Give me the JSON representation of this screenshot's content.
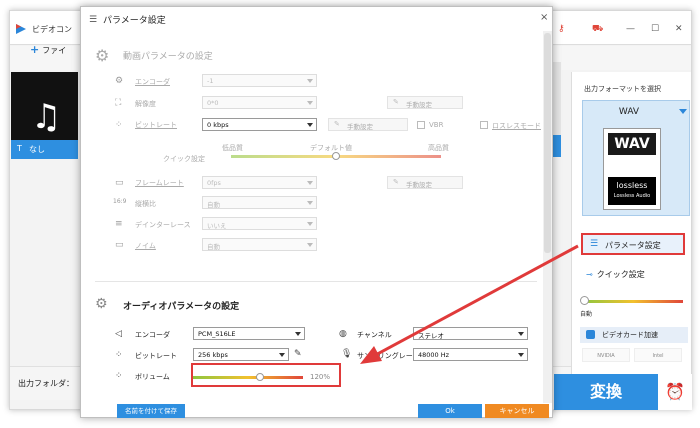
{
  "main": {
    "title": "ビデオコン",
    "add_file": "ファイ",
    "subtitle": "なし",
    "output_folder": "出力フォルダ：",
    "convert": "変換",
    "window_min": "—",
    "window_max": "☐",
    "window_close": "✕"
  },
  "right_panel": {
    "format_label": "出力フォーマットを選択",
    "format_name": "WAV",
    "format_icon_top": "WAV",
    "format_icon_bottom": "lossless",
    "format_icon_sub": "Lossless Audio",
    "param_button": "パラメータ設定",
    "quick_button": "クイック設定",
    "slider_label": "自動",
    "gpu_label": "ビデオカード加速",
    "vendors": [
      "NVIDIA",
      "Intel"
    ]
  },
  "dialog": {
    "title": "パラメータ設定",
    "close": "×",
    "video_section_title": "動画パラメータの設定",
    "video_rows": [
      {
        "label": "エンコーダ",
        "value": "-1"
      },
      {
        "label": "解像度",
        "value": "0*0",
        "manual": "手動設定"
      },
      {
        "label": "ビットレート",
        "value": "0 kbps",
        "manual": "手動設定",
        "vbr": "VBR",
        "lossless": "ロスレスモード"
      },
      {
        "label": "フレームレート",
        "value": "0fps",
        "manual": "手動設定"
      },
      {
        "label": "縦横比",
        "value": "自動"
      },
      {
        "label": "デインターレース",
        "value": "いいえ"
      },
      {
        "label": "ノイム",
        "value": "自動"
      }
    ],
    "quick_label": "クイック設定",
    "quality_low": "低品質",
    "quality_default": "デフォルト値",
    "quality_high": "高品質",
    "audio_section_title": "オーディオパラメータの設定",
    "audio": {
      "encoder_label": "エンコーダ",
      "encoder_value": "PCM_S16LE",
      "bitrate_label": "ビットレート",
      "bitrate_value": "256 kbps",
      "volume_label": "ボリューム",
      "volume_value": "120%",
      "channel_label": "チャンネル",
      "channel_value": "ステレオ",
      "samplerate_label": "サンプリングレート",
      "samplerate_value": "48000 Hz"
    },
    "btn_save_named": "名前を付けて保存",
    "btn_ok": "Ok",
    "btn_cancel": "キャンセル"
  }
}
